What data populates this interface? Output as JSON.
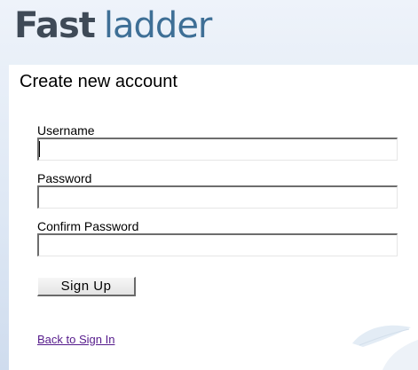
{
  "header": {
    "logo_part1": "Fast",
    "logo_part2": "ladder"
  },
  "form": {
    "title": "Create new account",
    "fields": [
      {
        "label": "Username",
        "value": ""
      },
      {
        "label": "Password",
        "value": ""
      },
      {
        "label": "Confirm Password",
        "value": ""
      }
    ],
    "submit_label": "Sign Up",
    "back_link": "Back to Sign In"
  },
  "colors": {
    "logo_dark": "#3f4a57",
    "logo_blue": "#3e6f96",
    "link_visited": "#551a8b"
  }
}
